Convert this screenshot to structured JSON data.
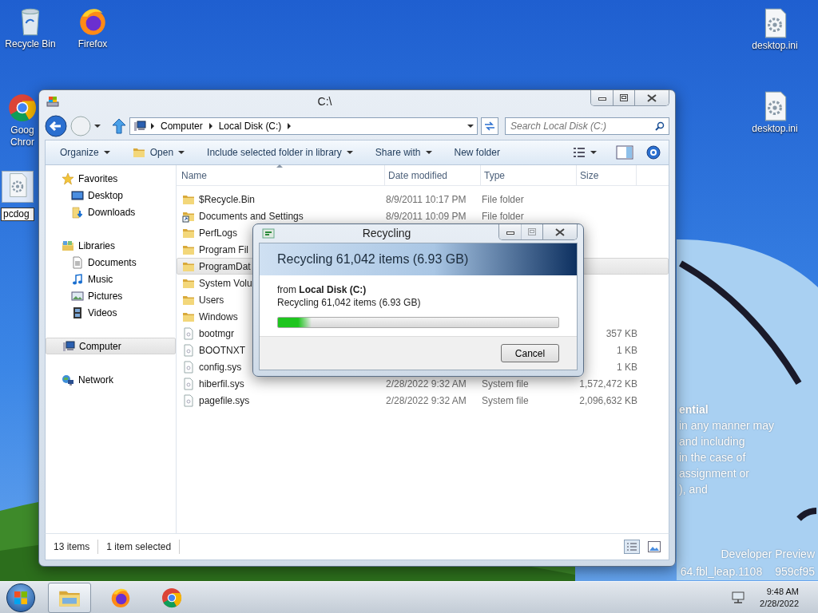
{
  "desktop_icons": [
    {
      "kind": "recycle-bin",
      "lines": [
        "Recycle Bin"
      ]
    },
    {
      "kind": "firefox",
      "lines": [
        "Firefox"
      ]
    },
    {
      "kind": "chrome",
      "lines": [
        "Goog",
        "Chror"
      ]
    },
    {
      "kind": "rename",
      "value": "pcdog"
    },
    {
      "kind": "settings-file",
      "lines": [
        "desktop.ini"
      ]
    },
    {
      "kind": "settings-file",
      "lines": [
        "desktop.ini"
      ]
    }
  ],
  "wallpaper_text": {
    "upper": [
      "ential",
      "in any manner may",
      "and including",
      "in the case of",
      "assignment or",
      "), and"
    ],
    "lower": [
      "Developer Preview"
    ],
    "build": [
      "64.fbl_leap.1108",
      "959cf95"
    ]
  },
  "explorer": {
    "title": "C:\\",
    "breadcrumb": [
      "Computer",
      "Local Disk (C:)"
    ],
    "search": {
      "placeholder": "Search Local Disk (C:)"
    },
    "commands": [
      {
        "label": "Organize",
        "kind": "menu"
      },
      {
        "label": "Open",
        "kind": "menu-icon"
      },
      {
        "label": "Include selected folder in library",
        "kind": "menu"
      },
      {
        "label": "Share with",
        "kind": "menu"
      },
      {
        "label": "New folder",
        "kind": "plain"
      }
    ],
    "nav": [
      {
        "label": "Favorites",
        "kind": "star",
        "selected": false,
        "children": [
          {
            "label": "Desktop",
            "kind": "monitor",
            "selected": false
          },
          {
            "label": "Downloads",
            "kind": "download",
            "selected": false
          }
        ]
      },
      {
        "label": "Libraries",
        "kind": "library",
        "selected": false,
        "children": [
          {
            "label": "Documents",
            "kind": "document",
            "selected": false
          },
          {
            "label": "Music",
            "kind": "music",
            "selected": false
          },
          {
            "label": "Pictures",
            "kind": "picture",
            "selected": false
          },
          {
            "label": "Videos",
            "kind": "video",
            "selected": false
          }
        ]
      },
      {
        "label": "Computer",
        "kind": "computer",
        "selected": true
      },
      {
        "label": "Network",
        "kind": "network",
        "selected": false
      }
    ],
    "columns": [
      "Name",
      "Date modified",
      "Type",
      "Size"
    ],
    "rows": [
      {
        "kind": "folder",
        "name": "$Recycle.Bin",
        "date": "8/9/2011 10:17 PM",
        "type": "File folder",
        "selected": false
      },
      {
        "kind": "shortcut-folder",
        "name": "Documents and Settings",
        "date": "8/9/2011 10:09 PM",
        "type": "File folder",
        "selected": false
      },
      {
        "kind": "folder",
        "name": "PerfLogs",
        "selected": false
      },
      {
        "kind": "folder",
        "name": "Program Fil",
        "selected": false
      },
      {
        "kind": "folder",
        "name": "ProgramDat",
        "selected": true
      },
      {
        "kind": "folder",
        "name": "System Volu",
        "selected": false
      },
      {
        "kind": "folder",
        "name": "Users",
        "selected": false
      },
      {
        "kind": "folder",
        "name": "Windows",
        "selected": false
      },
      {
        "kind": "file",
        "name": "bootmgr",
        "size": "357 KB",
        "selected": false
      },
      {
        "kind": "file",
        "name": "BOOTNXT",
        "size": "1 KB",
        "selected": false
      },
      {
        "kind": "file",
        "name": "config.sys",
        "size": "1 KB",
        "selected": false
      },
      {
        "kind": "file",
        "name": "hiberfil.sys",
        "date": "2/28/2022 9:32 AM",
        "type": "System file",
        "size": "1,572,472 KB",
        "selected": false
      },
      {
        "kind": "file",
        "name": "pagefile.sys",
        "date": "2/28/2022 9:32 AM",
        "type": "System file",
        "size": "2,096,632 KB",
        "selected": false
      }
    ],
    "status": [
      "13 items",
      "1 item selected"
    ]
  },
  "dialog": {
    "title": "Recycling",
    "maximize_disabled": true,
    "heading": "Recycling 61,042 items (6.93 GB)",
    "source": "from **Local Disk (C:)**",
    "detail": "Recycling 61,042 items (6.93 GB)",
    "level": 0.12,
    "button": "Cancel"
  },
  "taskbar": {
    "items": [
      {
        "kind": "explorer",
        "selected": true
      },
      {
        "kind": "firefox",
        "selected": false
      },
      {
        "kind": "chrome",
        "selected": false
      }
    ],
    "time": "9:48 AM",
    "date": "2/28/2022"
  }
}
